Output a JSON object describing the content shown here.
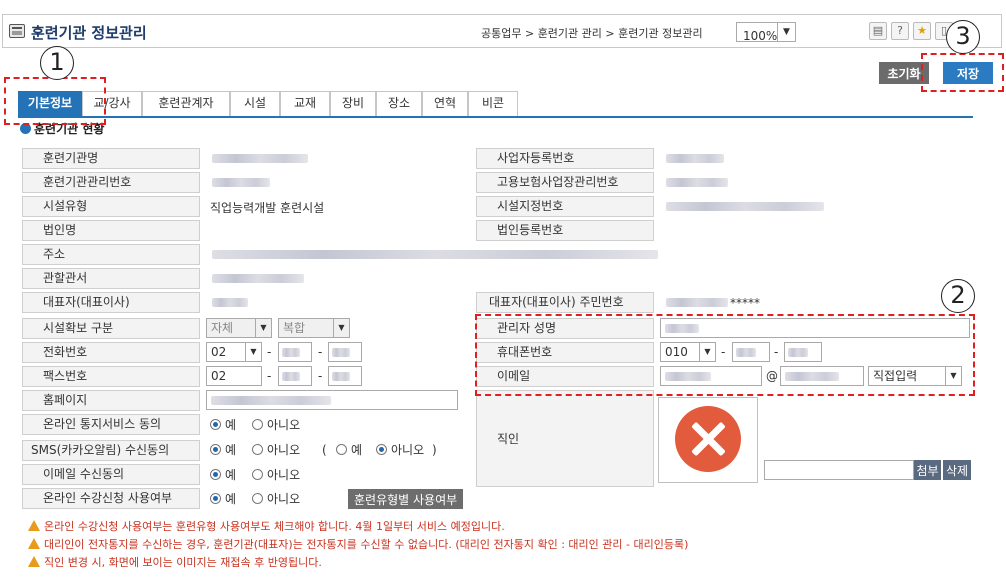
{
  "header": {
    "title": "훈련기관 정보관리",
    "breadcrumb": "공통업무 > 훈련기관 관리 > 훈련기관 정보관리",
    "zoom": "100%"
  },
  "actions": {
    "reset": "초기화",
    "save": "저장"
  },
  "tabs": [
    "기본정보",
    "교/강사",
    "훈련관계자",
    "시설",
    "교재",
    "장비",
    "장소",
    "연혁",
    "비콘"
  ],
  "section_title": "훈련기관 현황",
  "form": {
    "left_labels": [
      "훈련기관명",
      "훈련기관관리번호",
      "시설유형",
      "법인명",
      "주소",
      "관할관서",
      "대표자(대표이사)",
      "시설확보 구분",
      "전화번호",
      "팩스번호",
      "홈페이지",
      "온라인 통지서비스 동의",
      "SMS(카카오알림) 수신동의",
      "이메일 수신동의",
      "온라인 수강신청 사용여부"
    ],
    "right_labels": [
      "사업자등록번호",
      "고용보험사업장관리번호",
      "시설지정번호",
      "법인등록번호",
      "대표자(대표이사) 주민번호",
      "관리자 성명",
      "휴대폰번호",
      "이메일",
      "직인"
    ],
    "facility_type": "직업능력개발 훈련시설",
    "resident_number_mask": "*****",
    "facility_secure": {
      "opt1": "자체",
      "opt2": "복합"
    },
    "phone_prefix": "02",
    "fax_prefix": "02",
    "mobile_prefix": "010",
    "email_at": "@",
    "email_domain_select": "직접입력",
    "radio_yes": "예",
    "radio_no": "아니오",
    "sms_paren_open": "(",
    "sms_paren_close": ")",
    "training_type_button": "훈련유형별 사용여부",
    "attach_button": "첨부",
    "delete_button": "삭제"
  },
  "notes": [
    "온라인 수강신청 사용여부는 훈련유형 사용여부도 체크해야 합니다. 4월 1일부터 서비스 예정입니다.",
    "대리인이 전자통지를 수신하는 경우, 훈련기관(대표자)는 전자통지를 수신할 수 없습니다. (대리인 전자통지 확인 : 대리인 관리 - 대리인등록)",
    "직인 변경 시, 화면에 보이는 이미지는 재접속 후 반영됩니다."
  ],
  "markers": [
    "1",
    "2",
    "3"
  ],
  "colors": {
    "accent": "#2473b7",
    "marker": "#e02020",
    "warning": "#c8321f"
  }
}
